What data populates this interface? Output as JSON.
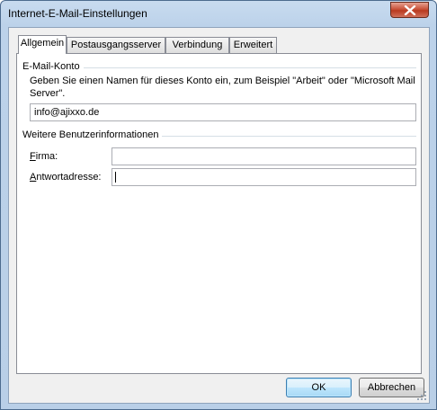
{
  "window": {
    "title": "Internet-E-Mail-Einstellungen"
  },
  "tabs": [
    {
      "label": "Allgemein",
      "active": true
    },
    {
      "label": "Postausgangsserver",
      "active": false
    },
    {
      "label": "Verbindung",
      "active": false
    },
    {
      "label": "Erweitert",
      "active": false
    }
  ],
  "email_account": {
    "heading": "E-Mail-Konto",
    "description": "Geben Sie einen Namen für dieses Konto ein, zum Beispiel \"Arbeit\" oder \"Microsoft Mail Server\".",
    "account_name": "info@ajixxo.de"
  },
  "user_info": {
    "heading": "Weitere Benutzerinformationen",
    "company_label_first": "F",
    "company_label_rest": "irma:",
    "company_value": "",
    "reply_label_first": "A",
    "reply_label_rest": "ntwortadresse:",
    "reply_value": ""
  },
  "buttons": {
    "ok": "OK",
    "cancel": "Abbrechen"
  },
  "icons": {
    "close": "close-icon",
    "resize": "resize-grip-icon"
  }
}
